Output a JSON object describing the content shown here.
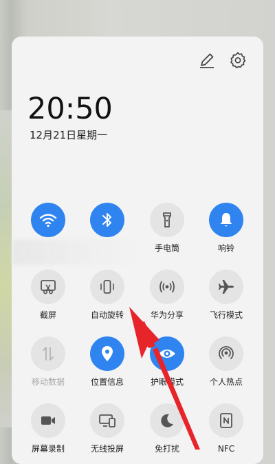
{
  "header": {
    "time": "20:50",
    "date": "12月21日星期一",
    "edit_icon": "pencil-icon",
    "settings_icon": "gear-icon"
  },
  "colors": {
    "accent": "#2f84f0",
    "tile_off": "#e4e4e4",
    "arrow": "#e8242b"
  },
  "tiles": [
    {
      "label": "",
      "icon": "wifi-icon",
      "active": true
    },
    {
      "label": "",
      "icon": "bluetooth-icon",
      "active": true
    },
    {
      "label": "手电筒",
      "icon": "flashlight-icon",
      "active": false
    },
    {
      "label": "响铃",
      "icon": "bell-icon",
      "active": true
    },
    {
      "label": "截屏",
      "icon": "screenshot-icon",
      "active": false
    },
    {
      "label": "自动旋转",
      "icon": "auto-rotate-icon",
      "active": false
    },
    {
      "label": "华为分享",
      "icon": "huawei-share-icon",
      "active": false
    },
    {
      "label": "飞行模式",
      "icon": "airplane-icon",
      "active": false
    },
    {
      "label": "移动数据",
      "icon": "mobile-data-icon",
      "active": false,
      "disabled": true
    },
    {
      "label": "位置信息",
      "icon": "location-icon",
      "active": true
    },
    {
      "label": "护眼模式",
      "icon": "eye-comfort-icon",
      "active": true
    },
    {
      "label": "个人热点",
      "icon": "hotspot-icon",
      "active": false
    },
    {
      "label": "屏幕录制",
      "icon": "screen-record-icon",
      "active": false
    },
    {
      "label": "无线投屏",
      "icon": "wireless-projection-icon",
      "active": false
    },
    {
      "label": "免打扰",
      "icon": "moon-icon",
      "active": false
    },
    {
      "label": "NFC",
      "icon": "nfc-icon",
      "active": false
    }
  ]
}
